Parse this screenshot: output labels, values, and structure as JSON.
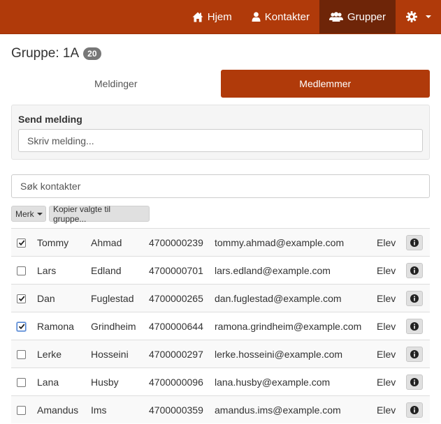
{
  "nav": {
    "items": [
      {
        "label": "Hjem",
        "icon": "home-icon",
        "active": false
      },
      {
        "label": "Kontakter",
        "icon": "user-icon",
        "active": false
      },
      {
        "label": "Grupper",
        "icon": "users-icon",
        "active": true
      }
    ],
    "settings_icon": "gear-icon"
  },
  "group": {
    "title": "Gruppe: 1A",
    "count": "20"
  },
  "tabs": [
    {
      "label": "Meldinger",
      "active": false
    },
    {
      "label": "Medlemmer",
      "active": true
    }
  ],
  "send": {
    "label": "Send melding",
    "placeholder": "Skriv melding..."
  },
  "search": {
    "placeholder": "Søk kontakter"
  },
  "toolbar": {
    "merk_label": "Merk",
    "copy_label": "Kopier valgte til gruppe..."
  },
  "contacts": [
    {
      "checked": true,
      "first": "Tommy",
      "last": "Ahmad",
      "phone": "4700000239",
      "email": "tommy.ahmad@example.com",
      "role": "Elev"
    },
    {
      "checked": false,
      "first": "Lars",
      "last": "Edland",
      "phone": "4700000701",
      "email": "lars.edland@example.com",
      "role": "Elev"
    },
    {
      "checked": true,
      "first": "Dan",
      "last": "Fuglestad",
      "phone": "4700000265",
      "email": "dan.fuglestad@example.com",
      "role": "Elev"
    },
    {
      "checked": true,
      "focus": true,
      "first": "Ramona",
      "last": "Grindheim",
      "phone": "4700000644",
      "email": "ramona.grindheim@example.com",
      "role": "Elev"
    },
    {
      "checked": false,
      "first": "Lerke",
      "last": "Hosseini",
      "phone": "4700000297",
      "email": "lerke.hosseini@example.com",
      "role": "Elev"
    },
    {
      "checked": false,
      "first": "Lana",
      "last": "Husby",
      "phone": "4700000096",
      "email": "lana.husby@example.com",
      "role": "Elev"
    },
    {
      "checked": false,
      "first": "Amandus",
      "last": "Ims",
      "phone": "4700000359",
      "email": "amandus.ims@example.com",
      "role": "Elev"
    }
  ],
  "colors": {
    "brand": "#b03a0a",
    "nav_active": "#6e2508"
  }
}
